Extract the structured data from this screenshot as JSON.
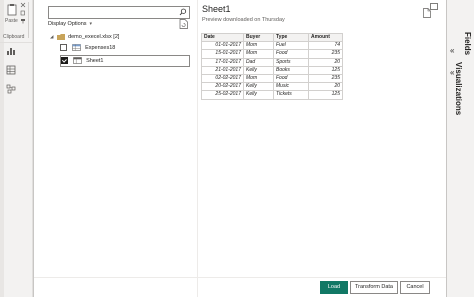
{
  "ribbon": {
    "paste_label": "Paste",
    "clipboard_label": "Clipboard"
  },
  "right_panes": {
    "fields_label": "Fields",
    "visualizations_label": "Visualizations",
    "collapse_icon": "double-chevron-left"
  },
  "navigator": {
    "search": {
      "value": "",
      "placeholder": ""
    },
    "display_options_label": "Display Options",
    "tree": {
      "file": {
        "label": "demo_execel.xlsx [2]",
        "expanded": true
      },
      "items": [
        {
          "label": "Expenses18",
          "checked": false,
          "icon": "table-icon"
        },
        {
          "label": "Sheet1",
          "checked": true,
          "icon": "sheet-icon",
          "selected": true
        }
      ]
    },
    "preview": {
      "title": "Sheet1",
      "subtitle": "Preview downloaded on Thursday",
      "columns": [
        "Date",
        "Buyer",
        "Type",
        "Amount"
      ],
      "rows": [
        [
          "01-01-2017",
          "Mom",
          "Fuel",
          "74"
        ],
        [
          "15-01-2017",
          "Mom",
          "Food",
          "235"
        ],
        [
          "17-01-2017",
          "Dad",
          "Sports",
          "20"
        ],
        [
          "21-01-2017",
          "Kelly",
          "Books",
          "125"
        ],
        [
          "02-02-2017",
          "Mom",
          "Food",
          "235"
        ],
        [
          "20-02-2017",
          "Kelly",
          "Music",
          "20"
        ],
        [
          "25-02-2017",
          "Kelly",
          "Tickets",
          "125"
        ]
      ]
    },
    "buttons": {
      "load": "Load",
      "transform": "Transform Data",
      "cancel": "Cancel"
    }
  },
  "colors": {
    "accent": "#117865",
    "border": "#8a8886",
    "header_bg": "#f3f2f1"
  }
}
